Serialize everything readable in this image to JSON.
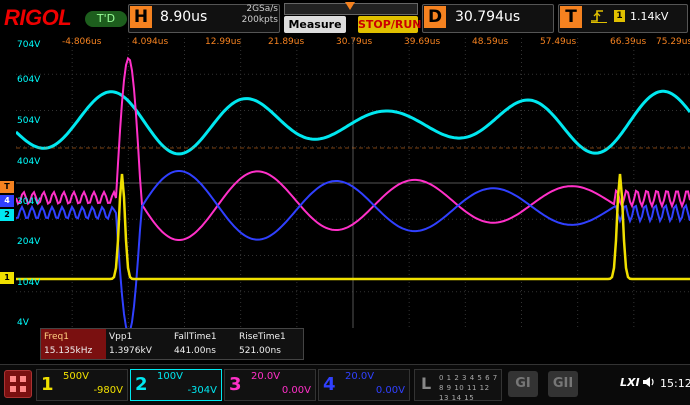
{
  "brand": "RIGOL",
  "mode_badge": "T'D",
  "horizontal": {
    "label": "H",
    "timebase": "8.90us",
    "sample_rate": "2GSa/s",
    "memory": "200kpts"
  },
  "buttons": {
    "measure": "Measure",
    "stop_run": "STOP/RUN"
  },
  "delay": {
    "label": "D",
    "value": "30.794us"
  },
  "trigger": {
    "label": "T",
    "edge_icon": "rising-edge-icon",
    "source": "1",
    "level": "1.14kV"
  },
  "time_labels": [
    "-4.806us",
    "4.094us",
    "12.99us",
    "21.89us",
    "30.79us",
    "39.69us",
    "48.59us",
    "57.49us",
    "66.39us",
    "75.29us"
  ],
  "voltage_labels": [
    "704V",
    "604V",
    "504V",
    "404V",
    "304V",
    "204V",
    "104V",
    "4V"
  ],
  "channel_markers": {
    "trig_level": "T",
    "ch4": "4",
    "ch2": "2",
    "ch1": "1"
  },
  "measurements": [
    {
      "name": "Freq1",
      "value": "15.135kHz",
      "selected": true
    },
    {
      "name": "Vpp1",
      "value": "1.3976kV",
      "selected": false
    },
    {
      "name": "FallTime1",
      "value": "441.00ns",
      "selected": false
    },
    {
      "name": "RiseTime1",
      "value": "521.00ns",
      "selected": false
    }
  ],
  "channels": [
    {
      "num": "1",
      "scale": "500V",
      "offset": "-980V",
      "color": "#f0e000"
    },
    {
      "num": "2",
      "scale": "100V",
      "offset": "-304V",
      "color": "#00e8f0"
    },
    {
      "num": "3",
      "scale": "20.0V",
      "offset": "0.00V",
      "color": "#ff30c8"
    },
    {
      "num": "4",
      "scale": "20.0V",
      "offset": "0.00V",
      "color": "#3040ff"
    }
  ],
  "logic": {
    "label": "L",
    "row1": "0 1 2 3 4 5 6 7",
    "row2": "8 9 10 11 12 13 14 15"
  },
  "gen_buttons": {
    "g1": "GI",
    "g2": "GII"
  },
  "status": {
    "lxi": "LXI",
    "time": "15:12"
  },
  "colors": {
    "accent": "#f58220",
    "ch1": "#f0e000",
    "ch2": "#00e8f0",
    "ch3": "#ff30c8",
    "ch4": "#3040ff"
  }
}
